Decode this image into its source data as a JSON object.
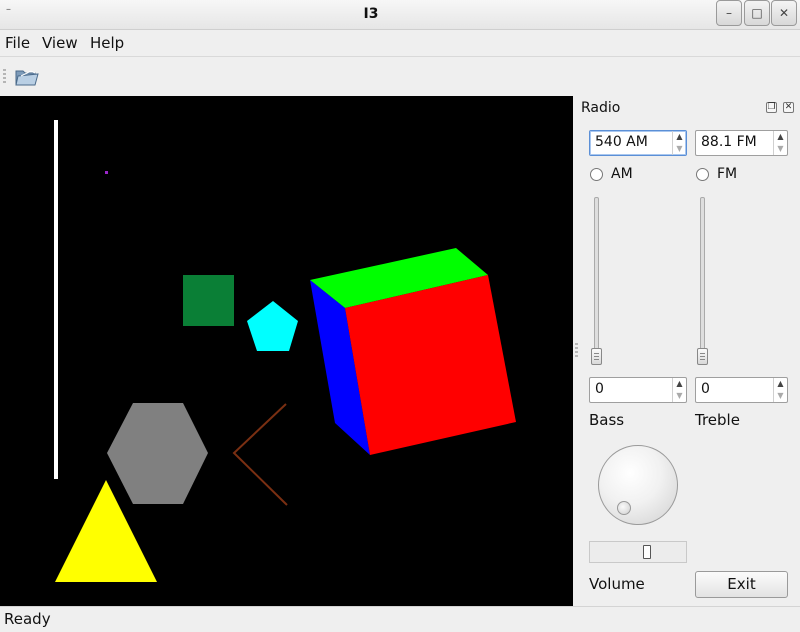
{
  "window": {
    "title": "I3",
    "sys_icon": "–",
    "min": "–",
    "max": "□",
    "close": "✕"
  },
  "menu": {
    "items": [
      "File",
      "View",
      "Help"
    ]
  },
  "toolbar": {
    "open_icon": "folder-open-icon"
  },
  "scene": {
    "background": "#000000",
    "shapes": [
      {
        "kind": "line",
        "color": "#ffffff"
      },
      {
        "kind": "point",
        "color": "#9b27c9"
      },
      {
        "kind": "square",
        "color": "#0a7f36"
      },
      {
        "kind": "pentagon",
        "color": "#00ffff"
      },
      {
        "kind": "cube",
        "colors": [
          "#00ff00",
          "#ff0000",
          "#0000ff"
        ]
      },
      {
        "kind": "hexagon",
        "color": "#808080"
      },
      {
        "kind": "chevron",
        "color": "#7a2f12"
      },
      {
        "kind": "triangle",
        "color": "#ffff00"
      }
    ]
  },
  "dock": {
    "title": "Radio",
    "am_spin": "540 AM",
    "fm_spin": "88.1 FM",
    "am_label": "AM",
    "fm_label": "FM",
    "am_selected": false,
    "fm_selected": false,
    "am_slider_level": 0,
    "fm_slider_level": 0,
    "bass_value": "0",
    "treble_value": "0",
    "bass_label": "Bass",
    "treble_label": "Treble",
    "volume_label": "Volume",
    "volume_level": 0.62,
    "exit_label": "Exit"
  },
  "status": {
    "text": "Ready"
  }
}
